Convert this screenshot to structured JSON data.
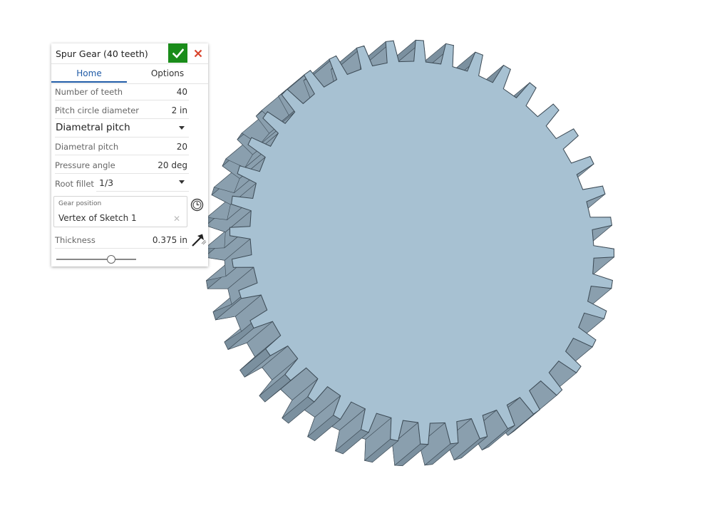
{
  "dialog": {
    "title": "Spur Gear (40 teeth)",
    "tabs": [
      {
        "label": "Home",
        "active": true
      },
      {
        "label": "Options",
        "active": false
      }
    ],
    "fields": {
      "number_of_teeth": {
        "label": "Number of teeth",
        "value": "40"
      },
      "pitch_circle_diameter": {
        "label": "Pitch circle diameter",
        "value": "2 in"
      },
      "pitch_mode": {
        "selected": "Diametral pitch"
      },
      "diametral_pitch": {
        "label": "Diametral pitch",
        "value": "20"
      },
      "pressure_angle": {
        "label": "Pressure angle",
        "value": "20 deg"
      },
      "root_fillet": {
        "label": "Root fillet",
        "selected": "1/3"
      },
      "gear_position": {
        "label": "Gear position",
        "value": "Vertex of Sketch 1"
      },
      "thickness": {
        "label": "Thickness",
        "value": "0.375 in"
      }
    },
    "slider_fraction": 0.68
  },
  "gear": {
    "teeth": 40,
    "face_color": "#a7c1d2",
    "flank_color": "#8197a6",
    "edge_color": "#3c4a55"
  },
  "colors": {
    "accent": "#1f5aa6",
    "accept": "#1a8c1a",
    "cancel": "#d9442c"
  },
  "icons": {
    "accept": "check-icon",
    "cancel": "close-icon",
    "clear": "clear-x-icon",
    "position": "clock-icon",
    "direction": "direction-arrow-icon",
    "caret": "caret-down-icon"
  }
}
